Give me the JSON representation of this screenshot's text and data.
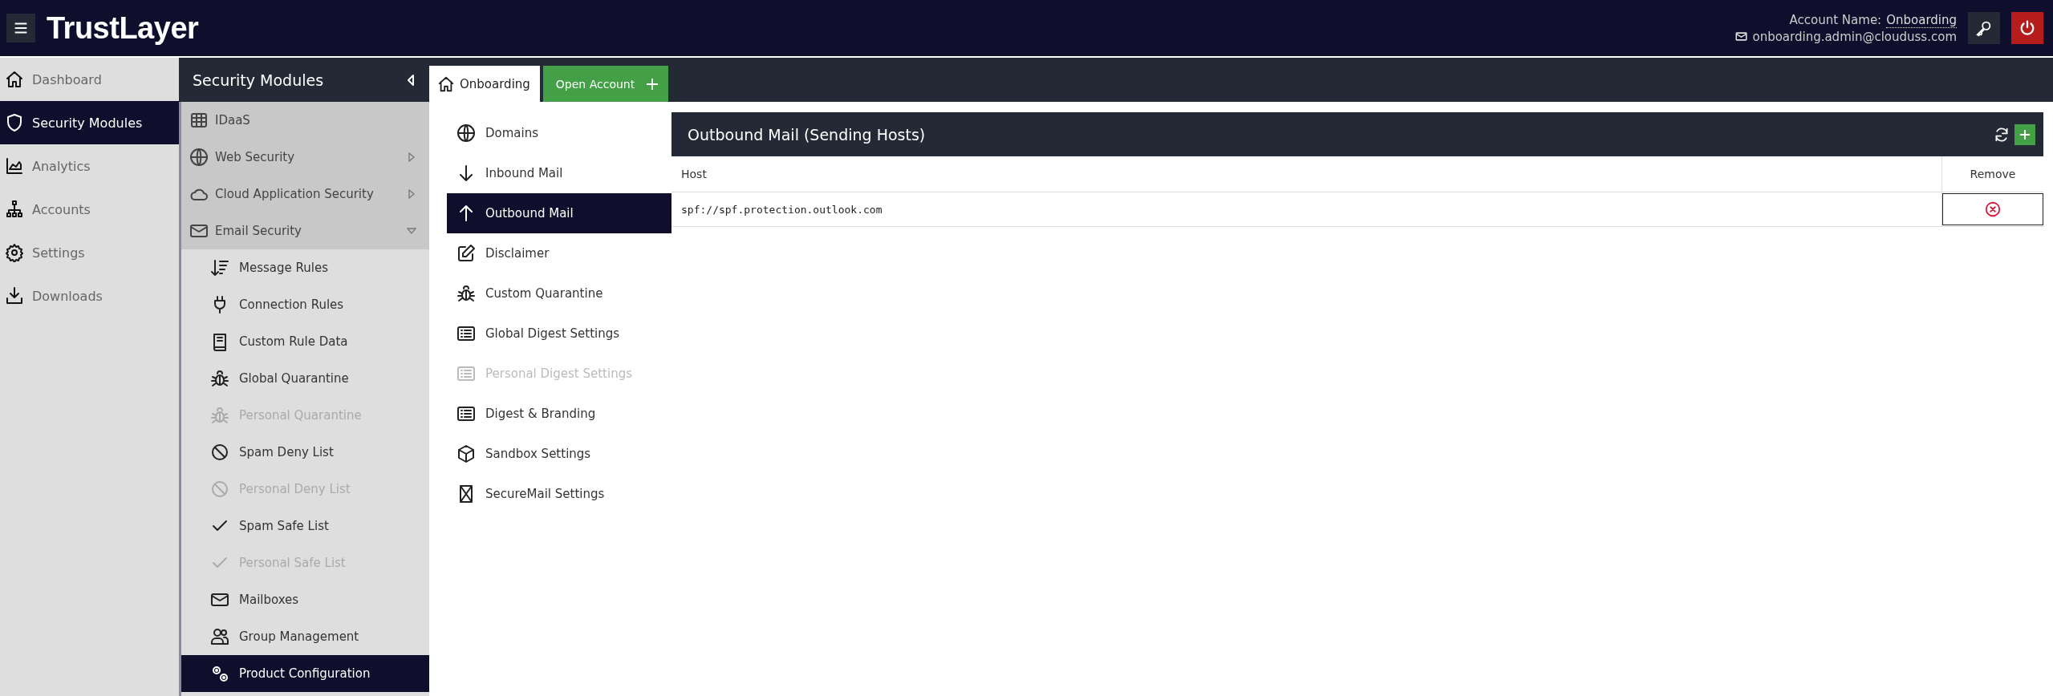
{
  "header": {
    "logo": "TrustLayer",
    "account_label": "Account Name:",
    "account_name": "Onboarding",
    "email": "onboarding.admin@clouduss.com"
  },
  "nav": [
    {
      "label": "Dashboard",
      "selected": false
    },
    {
      "label": "Security Modules",
      "selected": true
    },
    {
      "label": "Analytics",
      "selected": false
    },
    {
      "label": "Accounts",
      "selected": false
    },
    {
      "label": "Settings",
      "selected": false
    },
    {
      "label": "Downloads",
      "selected": false
    }
  ],
  "modules": {
    "title": "Security Modules",
    "items": [
      {
        "label": "IDaaS",
        "kind": "link"
      },
      {
        "label": "Web Security",
        "kind": "group",
        "expanded": false
      },
      {
        "label": "Cloud Application Security",
        "kind": "group",
        "expanded": false
      },
      {
        "label": "Email Security",
        "kind": "group",
        "expanded": true,
        "children": [
          {
            "label": "Message Rules",
            "disabled": false,
            "selected": false
          },
          {
            "label": "Connection Rules",
            "disabled": false,
            "selected": false
          },
          {
            "label": "Custom Rule Data",
            "disabled": false,
            "selected": false
          },
          {
            "label": "Global Quarantine",
            "disabled": false,
            "selected": false
          },
          {
            "label": "Personal Quarantine",
            "disabled": true,
            "selected": false
          },
          {
            "label": "Spam Deny List",
            "disabled": false,
            "selected": false
          },
          {
            "label": "Personal Deny List",
            "disabled": true,
            "selected": false
          },
          {
            "label": "Spam Safe List",
            "disabled": false,
            "selected": false
          },
          {
            "label": "Personal Safe List",
            "disabled": true,
            "selected": false
          },
          {
            "label": "Mailboxes",
            "disabled": false,
            "selected": false
          },
          {
            "label": "Group Management",
            "disabled": false,
            "selected": false
          },
          {
            "label": "Product Configuration",
            "disabled": false,
            "selected": true
          }
        ]
      }
    ]
  },
  "tabs": [
    {
      "label": "Onboarding",
      "selected": true
    }
  ],
  "open_account_button": "Open Account",
  "menu": [
    {
      "label": "Domains",
      "selected": false,
      "disabled": false
    },
    {
      "label": "Inbound Mail",
      "selected": false,
      "disabled": false
    },
    {
      "label": "Outbound Mail",
      "selected": true,
      "disabled": false
    },
    {
      "label": "Disclaimer",
      "selected": false,
      "disabled": false
    },
    {
      "label": "Custom Quarantine",
      "selected": false,
      "disabled": false
    },
    {
      "label": "Global Digest Settings",
      "selected": false,
      "disabled": false
    },
    {
      "label": "Personal Digest Settings",
      "selected": false,
      "disabled": true
    },
    {
      "label": "Digest & Branding",
      "selected": false,
      "disabled": false
    },
    {
      "label": "Sandbox Settings",
      "selected": false,
      "disabled": false
    },
    {
      "label": "SecureMail Settings",
      "selected": false,
      "disabled": false
    }
  ],
  "panel": {
    "title": "Outbound Mail (Sending Hosts)",
    "columns": [
      "Host",
      "Remove"
    ],
    "rows": [
      {
        "host": "spf://spf.protection.outlook.com"
      }
    ]
  }
}
